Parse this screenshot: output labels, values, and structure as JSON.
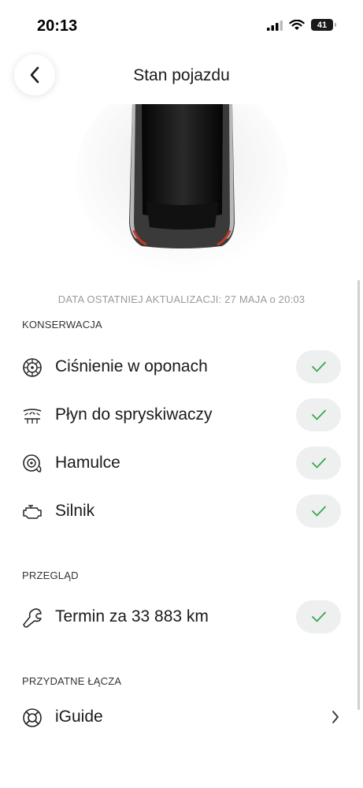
{
  "status_bar": {
    "time": "20:13",
    "battery": "41"
  },
  "nav": {
    "title": "Stan pojazdu"
  },
  "last_update": "DATA OSTATNIEJ AKTUALIZACJI: 27 MAJA o 20:03",
  "sections": {
    "maintenance": {
      "label": "KONSERWACJA",
      "items": [
        {
          "label": "Ciśnienie w oponach",
          "icon": "tire-pressure-icon",
          "status": "ok"
        },
        {
          "label": "Płyn do spryskiwaczy",
          "icon": "washer-fluid-icon",
          "status": "ok"
        },
        {
          "label": "Hamulce",
          "icon": "brakes-icon",
          "status": "ok"
        },
        {
          "label": "Silnik",
          "icon": "engine-icon",
          "status": "ok"
        }
      ]
    },
    "service": {
      "label": "PRZEGLĄD",
      "items": [
        {
          "label": "Termin za 33 883 km",
          "icon": "wrench-icon",
          "status": "ok"
        }
      ]
    },
    "links": {
      "label": "PRZYDATNE ŁĄCZA",
      "items": [
        {
          "label": "iGuide",
          "icon": "lifebuoy-icon"
        }
      ]
    }
  },
  "colors": {
    "check": "#3aa64a",
    "pill": "#eef0ef",
    "muted_text": "#9a9a9a",
    "car_accent": "#c0392b"
  }
}
